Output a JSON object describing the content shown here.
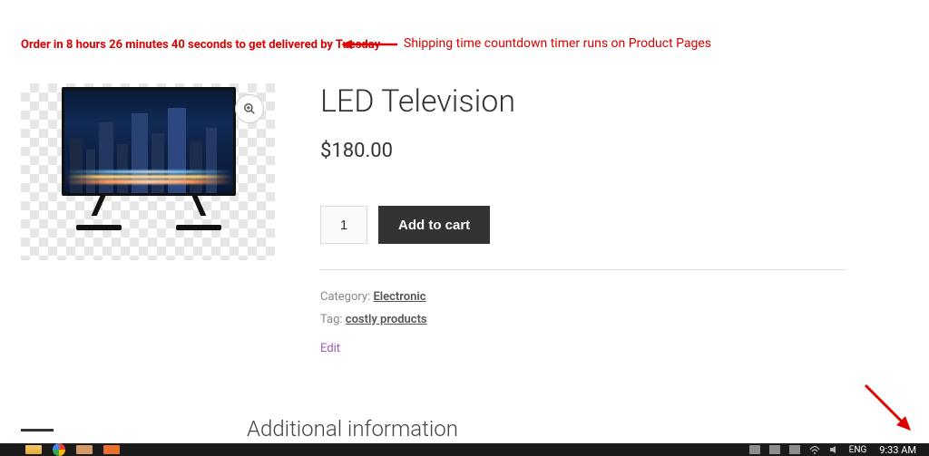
{
  "countdown": {
    "text": "Order in 8 hours 26 minutes 40 seconds to get delivered by Tuesday"
  },
  "annotation": {
    "text": "Shipping time countdown timer runs on Product Pages"
  },
  "product": {
    "title": "LED Television",
    "price": "$180.00",
    "quantity": "1",
    "add_to_cart_label": "Add to cart",
    "category_label": "Category:",
    "category_link": "Electronic",
    "tag_label": "Tag:",
    "tag_link": "costly products",
    "edit_label": "Edit",
    "additional_heading": "Additional information"
  },
  "taskbar": {
    "lang": "ENG",
    "time": "9:33 AM"
  }
}
